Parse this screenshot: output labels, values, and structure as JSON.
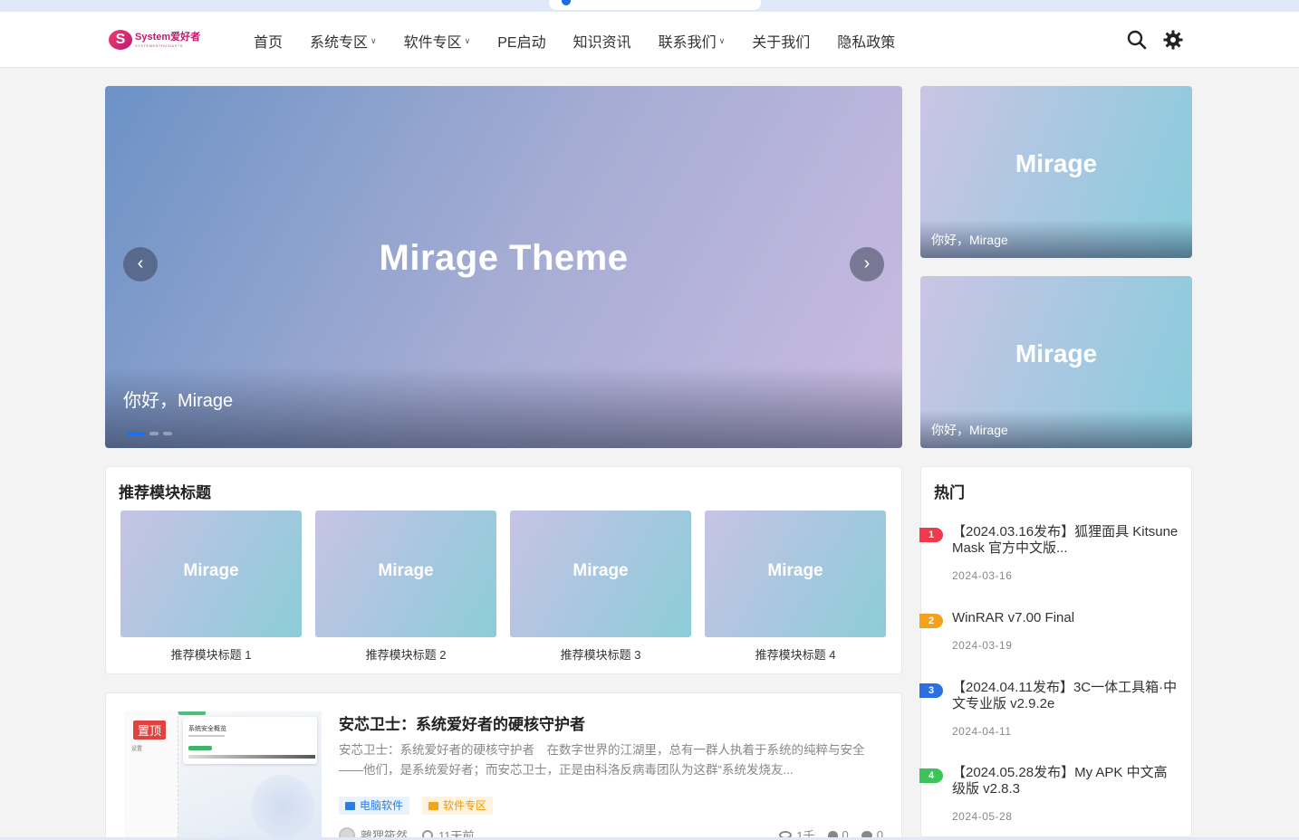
{
  "header": {
    "logo_mark": "S",
    "logo_main": "System爱好者",
    "logo_sub": "SYSTEMENTHUSIASTS",
    "nav": [
      {
        "label": "首页",
        "has_dropdown": false
      },
      {
        "label": "系统专区",
        "has_dropdown": true
      },
      {
        "label": "软件专区",
        "has_dropdown": true
      },
      {
        "label": "PE启动",
        "has_dropdown": false
      },
      {
        "label": "知识资讯",
        "has_dropdown": false
      },
      {
        "label": "联系我们",
        "has_dropdown": true
      },
      {
        "label": "关于我们",
        "has_dropdown": false
      },
      {
        "label": "隐私政策",
        "has_dropdown": false
      }
    ],
    "search_icon": "search-icon",
    "theme_icon": "gear-icon"
  },
  "slider": {
    "image_text": "Mirage Theme",
    "caption": "你好，Mirage",
    "prev": "‹",
    "next": "›",
    "dots": 3,
    "active_dot": 0
  },
  "side_banners": [
    {
      "image_text": "Mirage",
      "caption": "你好，Mirage"
    },
    {
      "image_text": "Mirage",
      "caption": "你好，Mirage"
    }
  ],
  "recommend": {
    "title": "推荐模块标题",
    "items": [
      {
        "image_text": "Mirage",
        "label": "推荐模块标题 1"
      },
      {
        "image_text": "Mirage",
        "label": "推荐模块标题 2"
      },
      {
        "image_text": "Mirage",
        "label": "推荐模块标题 3"
      },
      {
        "image_text": "Mirage",
        "label": "推荐模块标题 4"
      }
    ]
  },
  "hot": {
    "title": "热门",
    "items": [
      {
        "rank": "1",
        "title": "【2024.03.16发布】狐狸面具 Kitsune Mask 官方中文版...",
        "date": "2024-03-16",
        "color": "#f0394a"
      },
      {
        "rank": "2",
        "title": "WinRAR v7.00 Final",
        "date": "2024-03-19",
        "color": "#f6a11c"
      },
      {
        "rank": "3",
        "title": "【2024.04.11发布】3C一体工具箱·中文专业版 v2.9.2e",
        "date": "2024-04-11",
        "color": "#2b6fe0"
      },
      {
        "rank": "4",
        "title": "【2024.05.28发布】My APK 中文高级版 v2.8.3",
        "date": "2024-05-28",
        "color": "#3cc35a"
      }
    ]
  },
  "post": {
    "badge": "置顶",
    "thumb_text": "系统安全概览",
    "thumb_side": "设置",
    "title": "安芯卫士：系统爱好者的硬核守护者",
    "excerpt": "安芯卫士：系统爱好者的硬核守护者　在数字世界的江湖里，总有一群人执着于系统的纯粹与安全——他们，是系统爱好者；而安芯卫士，正是由科洛反病毒团队为这群“系统发烧友...",
    "tags": [
      "电脑软件",
      "软件专区"
    ],
    "author": "離狸筱然",
    "time": "11天前",
    "views": "1千",
    "likes": "0",
    "comments": "0"
  }
}
